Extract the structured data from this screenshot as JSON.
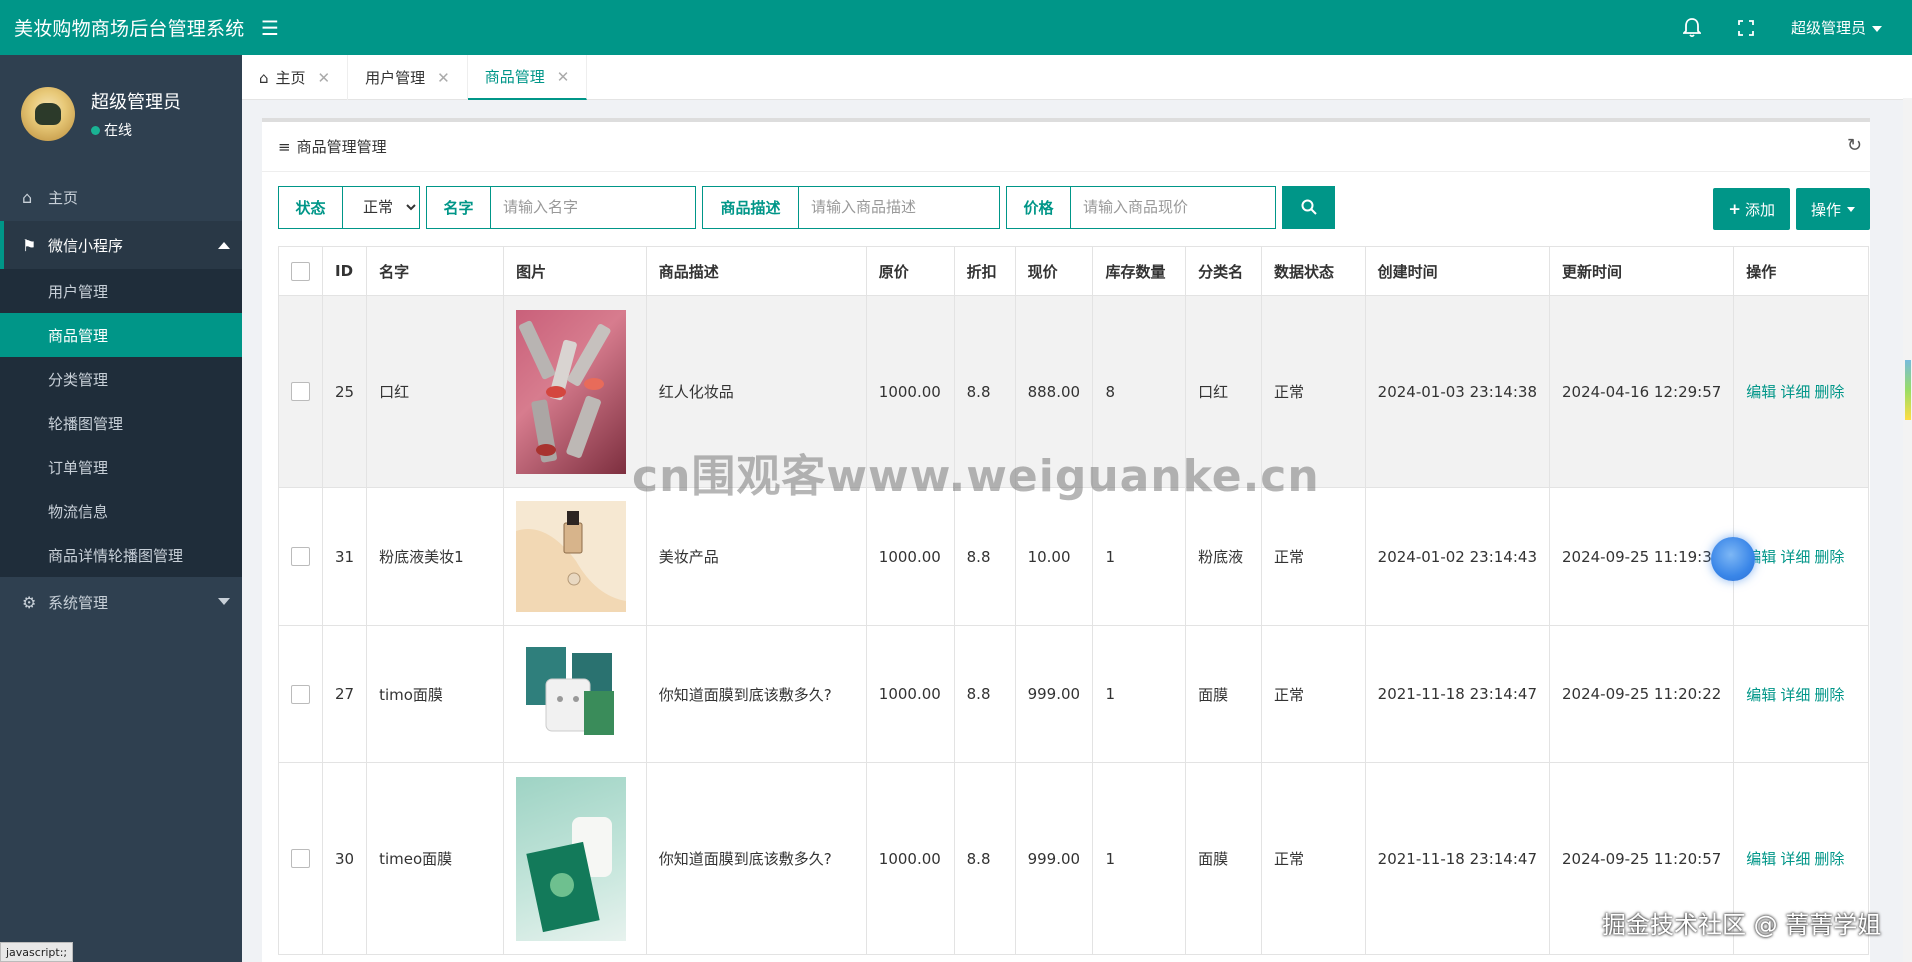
{
  "app": {
    "title": "美妆购物商场后台管理系统"
  },
  "topbar": {
    "user_label": "超级管理员"
  },
  "sidebar": {
    "profile": {
      "name": "超级管理员",
      "status": "在线"
    },
    "home": "主页",
    "group_miniprogram": "微信小程序",
    "items": [
      "用户管理",
      "商品管理",
      "分类管理",
      "轮播图管理",
      "订单管理",
      "物流信息",
      "商品详情轮播图管理"
    ],
    "group_system": "系统管理"
  },
  "tabs": [
    {
      "label": "主页"
    },
    {
      "label": "用户管理"
    },
    {
      "label": "商品管理"
    }
  ],
  "panel": {
    "title": "商品管理管理"
  },
  "filters": {
    "status_label": "状态",
    "status_value": "正常",
    "name_label": "名字",
    "name_placeholder": "请输入名字",
    "desc_label": "商品描述",
    "desc_placeholder": "请输入商品描述",
    "price_label": "价格",
    "price_placeholder": "请输入商品现价",
    "add_label": "添加",
    "ops_label": "操作"
  },
  "table": {
    "headers": [
      "ID",
      "名字",
      "图片",
      "商品描述",
      "原价",
      "折扣",
      "现价",
      "库存数量",
      "分类名",
      "数据状态",
      "创建时间",
      "更新时间",
      "操作"
    ],
    "rows": [
      {
        "id": "25",
        "name": "口红",
        "desc": "红人化妆品",
        "orig": "1000.00",
        "disc": "8.8",
        "price": "888.00",
        "stock": "8",
        "cat": "口红",
        "state": "正常",
        "created": "2024-01-03 23:14:38",
        "updated": "2024-04-16 12:29:57"
      },
      {
        "id": "31",
        "name": "粉底液美妆1",
        "desc": "美妆产品",
        "orig": "1000.00",
        "disc": "8.8",
        "price": "10.00",
        "stock": "1",
        "cat": "粉底液",
        "state": "正常",
        "created": "2024-01-02 23:14:43",
        "updated": "2024-09-25 11:19:32"
      },
      {
        "id": "27",
        "name": "timo面膜",
        "desc": "你知道面膜到底该敷多久?",
        "orig": "1000.00",
        "disc": "8.8",
        "price": "999.00",
        "stock": "1",
        "cat": "面膜",
        "state": "正常",
        "created": "2021-11-18 23:14:47",
        "updated": "2024-09-25 11:20:22"
      },
      {
        "id": "30",
        "name": "timeo面膜",
        "desc": "你知道面膜到底该敷多久?",
        "orig": "1000.00",
        "disc": "8.8",
        "price": "999.00",
        "stock": "1",
        "cat": "面膜",
        "state": "正常",
        "created": "2021-11-18 23:14:47",
        "updated": "2024-09-25 11:20:57"
      }
    ],
    "ops": {
      "edit": "编辑",
      "detail": "详细",
      "delete": "删除"
    }
  },
  "overlay": {
    "watermark": "cn围观客www.weiguanke.cn",
    "corner": "掘金技术社区 @ 菁菁学姐",
    "statusbar": "javascript:;"
  },
  "colors": {
    "accent": "#009688",
    "sidebar": "#2f4050"
  }
}
